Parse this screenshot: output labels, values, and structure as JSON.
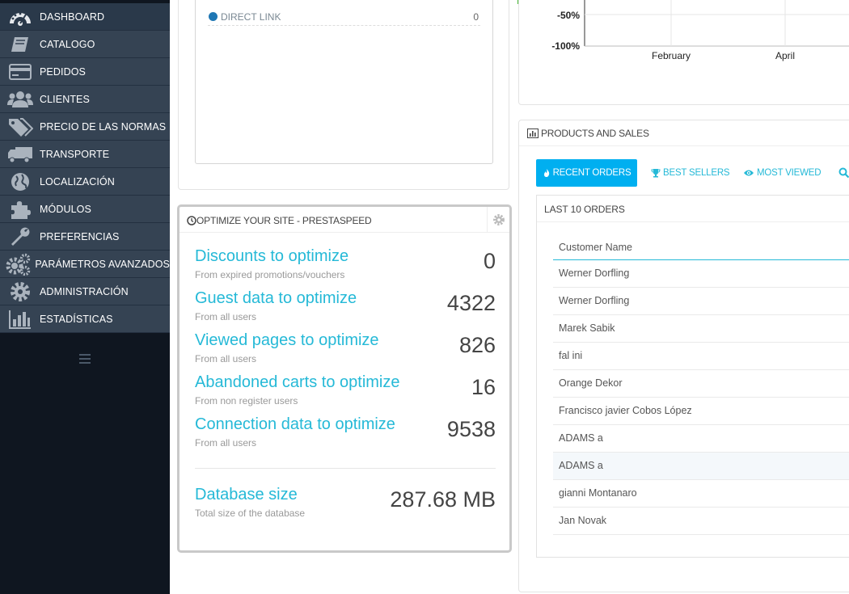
{
  "sidebar": {
    "items": [
      {
        "label": "DASHBOARD",
        "icon": "dashboard-icon"
      },
      {
        "label": "CATALOGO",
        "icon": "book-icon"
      },
      {
        "label": "PEDIDOS",
        "icon": "credit-card-icon"
      },
      {
        "label": "CLIENTES",
        "icon": "users-icon"
      },
      {
        "label": "PRECIO DE LAS NORMAS",
        "icon": "tags-icon"
      },
      {
        "label": "TRANSPORTE",
        "icon": "truck-icon"
      },
      {
        "label": "LOCALIZACIÓN",
        "icon": "globe-icon"
      },
      {
        "label": "MÓDULOS",
        "icon": "puzzle-icon"
      },
      {
        "label": "PREFERENCIAS",
        "icon": "wrench-icon"
      },
      {
        "label": "PARÁMETROS AVANZADOS",
        "icon": "cogs-icon"
      },
      {
        "label": "ADMINISTRACIÓN",
        "icon": "gear-icon"
      },
      {
        "label": "ESTADÍSTICAS",
        "icon": "bar-chart-icon"
      }
    ],
    "active_index": 0
  },
  "traffic": {
    "row_label": "DIRECT LINK",
    "row_value": "0"
  },
  "chart_data": {
    "type": "line",
    "y_tick_labels": [
      "-50%",
      "-100%"
    ],
    "x_tick_labels": [
      "February",
      "April"
    ]
  },
  "optimize": {
    "title": "OPTIMIZE YOUR SITE - PRESTASPEED",
    "items": [
      {
        "title": "Discounts to optimize",
        "subtitle": "From expired promotions/vouchers",
        "value": "0"
      },
      {
        "title": "Guest data to optimize",
        "subtitle": "From all users",
        "value": "4322"
      },
      {
        "title": "Viewed pages to optimize",
        "subtitle": "From all users",
        "value": "826"
      },
      {
        "title": "Abandoned carts to optimize",
        "subtitle": "From non register users",
        "value": "16"
      },
      {
        "title": "Connection data to optimize",
        "subtitle": "From all users",
        "value": "9538"
      }
    ],
    "db": {
      "title": "Database size",
      "subtitle": "Total size of the database",
      "value": "287.68 MB"
    }
  },
  "products": {
    "title": "PRODUCTS AND SALES",
    "tabs": [
      "RECENT ORDERS",
      "BEST SELLERS",
      "MOST VIEWED"
    ],
    "orders_title": "LAST 10 ORDERS",
    "column_header": "Customer Name",
    "orders": [
      "Werner Dorfling",
      "Werner Dorfling",
      "Marek Sabik",
      "fal ini",
      "Orange Dekor",
      "Francisco javier Cobos López",
      "ADAMS a",
      "ADAMS a",
      "gianni Montanaro",
      "Jan Novak"
    ]
  },
  "colors": {
    "sidebar_item": "#354353",
    "accent": "#25b9d7",
    "active_tab": "#00aff0",
    "top_bar": "#48b837"
  }
}
